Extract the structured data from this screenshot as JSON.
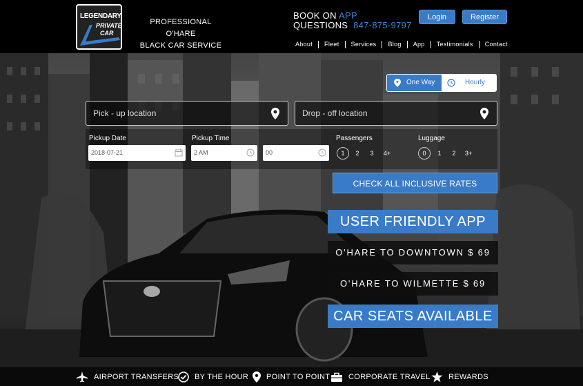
{
  "header": {
    "logo": {
      "line1": "LEGENDARY",
      "line2": "PRIVATE",
      "line3": "CAR"
    },
    "tagline_line1": "PROFESSIONAL O'HARE",
    "tagline_line2": "BLACK CAR SERVICE",
    "book_label": "BOOK ON",
    "book_app": "APP",
    "questions_label": "QUESTIONS",
    "phone": "847-875-9797",
    "login_label": "Login",
    "register_label": "Register"
  },
  "nav": {
    "items": [
      "About",
      "Fleet",
      "Services",
      "Blog",
      "App",
      "Testimonials",
      "Contact"
    ]
  },
  "booking": {
    "one_way_label": "One Way",
    "hourly_label": "Hourly",
    "pickup_placeholder": "Pick - up location",
    "dropoff_placeholder": "Drop - off location",
    "pickup_date_label": "Pickup Date",
    "pickup_date_value": "2018-07-21",
    "pickup_time_label": "Pickup Time",
    "pickup_hour_value": "2 AM",
    "pickup_minute_value": "00",
    "passengers_label": "Passengers",
    "passenger_options": [
      "1",
      "2",
      "3",
      "4+"
    ],
    "luggage_label": "Luggage",
    "luggage_options": [
      "0",
      "1",
      "2",
      "3+"
    ],
    "check_rates_label": "CHECK ALL INCLUSIVE RATES"
  },
  "promos": {
    "user_friendly_app": "USER FRIENDLY APP",
    "ohare_downtown": "O'HARE TO DOWNTOWN   $ 69",
    "ohare_wilmette": "O'HARE TO WILMETTE   $ 69",
    "car_seats": "CAR SEATS AVAILABLE"
  },
  "features": [
    "AIRPORT TRANSFERS",
    "BY THE HOUR",
    "POINT TO POINT",
    "CORPORATE TRAVEL",
    "REWARDS"
  ],
  "colors": {
    "accent": "#3a7bc8",
    "phone": "#3e86d8",
    "background": "#000000"
  }
}
